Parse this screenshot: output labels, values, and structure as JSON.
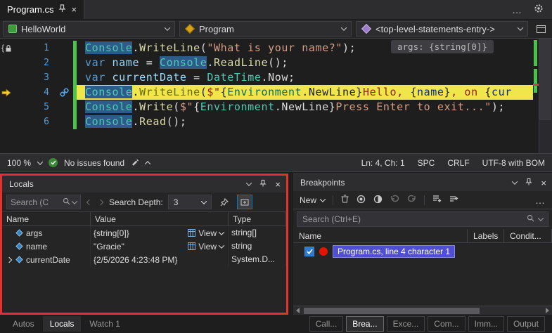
{
  "window": {
    "tab_title": "Program.cs",
    "overflow_label": "…"
  },
  "navbar": {
    "project": "HelloWorld",
    "class": "Program",
    "member": "<top-level-statements-entry->"
  },
  "editor": {
    "inlay_hint": "args: {string[0]}",
    "lines": [
      {
        "num": "1",
        "gutter": "brace-lock",
        "tokens": [
          {
            "t": "Console",
            "c": "cls",
            "sel": true
          },
          {
            "t": ".",
            "c": "pl"
          },
          {
            "t": "WriteLine",
            "c": "m"
          },
          {
            "t": "(",
            "c": "pl"
          },
          {
            "t": "\"What is your name?\"",
            "c": "str"
          },
          {
            "t": ");",
            "c": "pl"
          }
        ]
      },
      {
        "num": "2",
        "tokens": [
          {
            "t": "var",
            "c": "kw"
          },
          {
            "t": " ",
            "c": "pl"
          },
          {
            "t": "name",
            "c": "v"
          },
          {
            "t": " = ",
            "c": "pl"
          },
          {
            "t": "Console",
            "c": "cls",
            "sel": true
          },
          {
            "t": ".",
            "c": "pl"
          },
          {
            "t": "ReadLine",
            "c": "m"
          },
          {
            "t": "();",
            "c": "pl"
          }
        ]
      },
      {
        "num": "3",
        "tokens": [
          {
            "t": "var",
            "c": "kw"
          },
          {
            "t": " ",
            "c": "pl"
          },
          {
            "t": "currentDate",
            "c": "v"
          },
          {
            "t": " = ",
            "c": "pl"
          },
          {
            "t": "DateTime",
            "c": "cls"
          },
          {
            "t": ".Now;",
            "c": "pl"
          }
        ]
      },
      {
        "num": "4",
        "current": true,
        "gutter": "arrow",
        "link_icon": true,
        "tokens": [
          {
            "t": "Console",
            "c": "cls",
            "sel": true
          },
          {
            "t": ".",
            "c": "pl"
          },
          {
            "t": "WriteLine",
            "c": "m"
          },
          {
            "t": "(",
            "c": "pl"
          },
          {
            "t": "$\"",
            "c": "str"
          },
          {
            "t": "{",
            "c": "pl"
          },
          {
            "t": "Environment",
            "c": "cls"
          },
          {
            "t": ".NewLine",
            "c": "pl"
          },
          {
            "t": "}",
            "c": "pl"
          },
          {
            "t": "Hello, ",
            "c": "str"
          },
          {
            "t": "{",
            "c": "pl"
          },
          {
            "t": "name",
            "c": "v"
          },
          {
            "t": "}",
            "c": "pl"
          },
          {
            "t": ", on ",
            "c": "str"
          },
          {
            "t": "{",
            "c": "pl"
          },
          {
            "t": "cur",
            "c": "v"
          }
        ]
      },
      {
        "num": "5",
        "tokens": [
          {
            "t": "Console",
            "c": "cls",
            "sel": true
          },
          {
            "t": ".",
            "c": "pl"
          },
          {
            "t": "Write",
            "c": "m"
          },
          {
            "t": "(",
            "c": "pl"
          },
          {
            "t": "$\"",
            "c": "str"
          },
          {
            "t": "{",
            "c": "pl"
          },
          {
            "t": "Environment",
            "c": "cls"
          },
          {
            "t": ".NewLine",
            "c": "pl"
          },
          {
            "t": "}",
            "c": "pl"
          },
          {
            "t": "Press Enter to exit...\"",
            "c": "str"
          },
          {
            "t": ");",
            "c": "pl"
          }
        ]
      },
      {
        "num": "6",
        "tokens": [
          {
            "t": "Console",
            "c": "cls",
            "sel": true
          },
          {
            "t": ".",
            "c": "pl"
          },
          {
            "t": "Read",
            "c": "m"
          },
          {
            "t": "();",
            "c": "pl"
          }
        ]
      }
    ]
  },
  "statusbar": {
    "zoom": "100 %",
    "issues": "No issues found",
    "caret": "Ln: 4, Ch: 1",
    "space_mode": "SPC",
    "eol": "CRLF",
    "encoding": "UTF-8 with BOM"
  },
  "locals": {
    "title": "Locals",
    "search_placeholder": "Search (C",
    "depth_label": "Search Depth:",
    "depth_value": "3",
    "view_label": "View",
    "columns": [
      "Name",
      "Value",
      "Type"
    ],
    "rows": [
      {
        "name": "args",
        "value": "{string[0]}",
        "has_view": true,
        "type": "string[]"
      },
      {
        "name": "name",
        "value": "\"Gracie\"",
        "has_view": true,
        "type": "string"
      },
      {
        "name": "currentDate",
        "value": "{2/5/2026 4:23:48 PM}",
        "expandable": true,
        "type": "System.D..."
      }
    ],
    "tabs": [
      {
        "label": "Autos",
        "active": false
      },
      {
        "label": "Locals",
        "active": true
      },
      {
        "label": "Watch 1",
        "active": false
      }
    ]
  },
  "breakpoints": {
    "title": "Breakpoints",
    "new_label": "New",
    "search_placeholder": "Search (Ctrl+E)",
    "columns": [
      "Name",
      "Labels",
      "Condit..."
    ],
    "rows": [
      {
        "label": "Program.cs, line 4 character 1",
        "checked": true,
        "selected": true
      }
    ],
    "tabs": [
      {
        "label": "Call...",
        "active": false
      },
      {
        "label": "Brea...",
        "active": true
      },
      {
        "label": "Exce...",
        "active": false
      },
      {
        "label": "Com...",
        "active": false
      },
      {
        "label": "Imm...",
        "active": false
      },
      {
        "label": "Output",
        "active": false
      }
    ]
  },
  "colors": {
    "accent": "#007ACC",
    "current_line_bg": "#EEE64A",
    "symbol_highlight": "#2E5C8A",
    "breakpoint_red": "#E51400",
    "annotation_red": "#E5312B",
    "change_bar_green": "#4CC14C"
  }
}
